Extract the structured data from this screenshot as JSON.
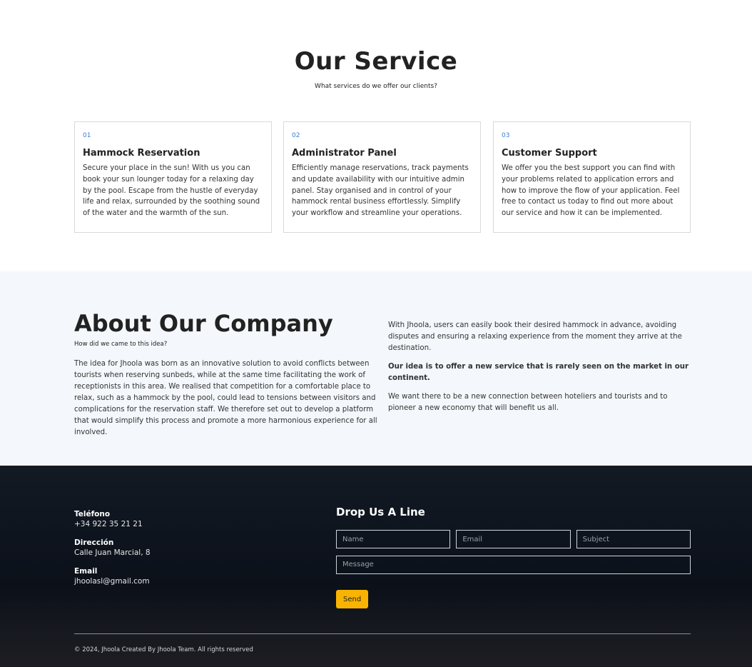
{
  "services": {
    "title": "Our Service",
    "subtitle": "What services do we offer our clients?",
    "cards": [
      {
        "number": "01",
        "title": "Hammock Reservation",
        "text": "Secure your place in the sun! With us you can book your sun lounger today for a relaxing day by the pool. Escape from the hustle of everyday life and relax, surrounded by the soothing sound of the water and the warmth of the sun."
      },
      {
        "number": "02",
        "title": "Administrator Panel",
        "text": "Efficiently manage reservations, track payments and update availability with our intuitive admin panel. Stay organised and in control of your hammock rental business effortlessly. Simplify your workflow and streamline your operations."
      },
      {
        "number": "03",
        "title": "Customer Support",
        "text": "We offer you the best support you can find with your problems related to application errors and how to improve the flow of your application. Feel free to contact us today to find out more about our service and how it can be implemented."
      }
    ]
  },
  "about": {
    "title": "About Our Company",
    "subtitle": "How did we came to this idea?",
    "left_text": "The idea for Jhoola was born as an innovative solution to avoid conflicts between tourists when reserving sunbeds, while at the same time facilitating the work of receptionists in this area. We realised that competition for a comfortable place to relax, such as a hammock by the pool, could lead to tensions between visitors and complications for the reservation staff. We therefore set out to develop a platform that would simplify this process and promote a more harmonious experience for all involved.",
    "right_p1": "With Jhoola, users can easily book their desired hammock in advance, avoiding disputes and ensuring a relaxing experience from the moment they arrive at the destination.",
    "right_p2": "Our idea is to offer a new service that is rarely seen on the market in our continent.",
    "right_p3": "We want there to be a new connection between hoteliers and tourists and to pioneer a new economy that will benefit us all."
  },
  "footer": {
    "contact": {
      "phone_label": "Teléfono",
      "phone": "+34 922 35 21 21",
      "address_label": "Dirección",
      "address": "Calle Juan Marcial, 8",
      "email_label": "Email",
      "email": "jhoolasl@gmail.com"
    },
    "form": {
      "title": "Drop Us A Line",
      "name_placeholder": "Name",
      "email_placeholder": "Email",
      "subject_placeholder": "Subject",
      "message_placeholder": "Message",
      "send_label": "Send"
    },
    "copyright": "© 2024, Jhoola Created By Jhoola Team. All rights reserved"
  },
  "colors": {
    "accent_blue": "#3b7dd8",
    "send_button": "#f8b400",
    "about_bg": "#f4f7fb",
    "footer_bg": "#0b1019"
  }
}
